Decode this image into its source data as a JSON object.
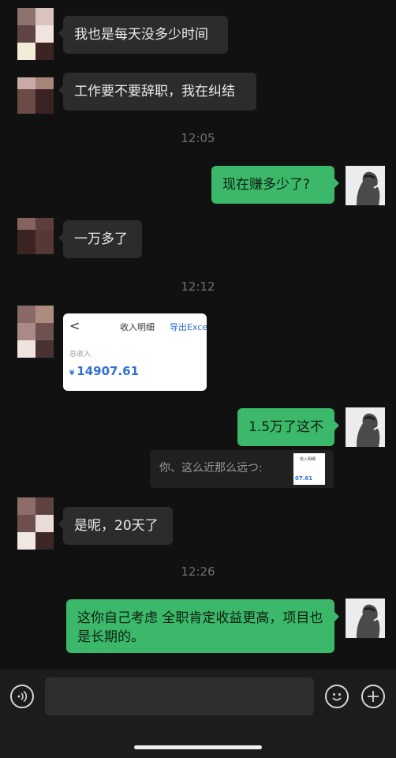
{
  "messages": {
    "m1": "我也是每天没多少时间",
    "m2": "工作要不要辞职，我在纠结",
    "t1": "12:05",
    "m3": "现在赚多少了?",
    "m4": "一万多了",
    "t2": "12:12",
    "card": {
      "back": "<",
      "title": "收入明细",
      "export": "导出Excel",
      "label": "总收入",
      "currency": "¥",
      "amount": "14907.61"
    },
    "m5": "1.5万了这不",
    "quote": {
      "text": "你、这么近那么远つ:",
      "thumb_title": "收入明细",
      "thumb_amount": "07.61"
    },
    "m6": "是呢，20天了",
    "t3": "12:26",
    "m7": "这你自己考虑 全职肯定收益更高，项目也是长期的。"
  },
  "colors": {
    "background": "#111111",
    "incoming_bubble": "#2c2c2c",
    "outgoing_bubble": "#3cb86a",
    "link_blue": "#2f6fd6"
  },
  "icons": {
    "voice": "voice-icon",
    "emoji": "emoji-icon",
    "plus": "plus-icon"
  }
}
